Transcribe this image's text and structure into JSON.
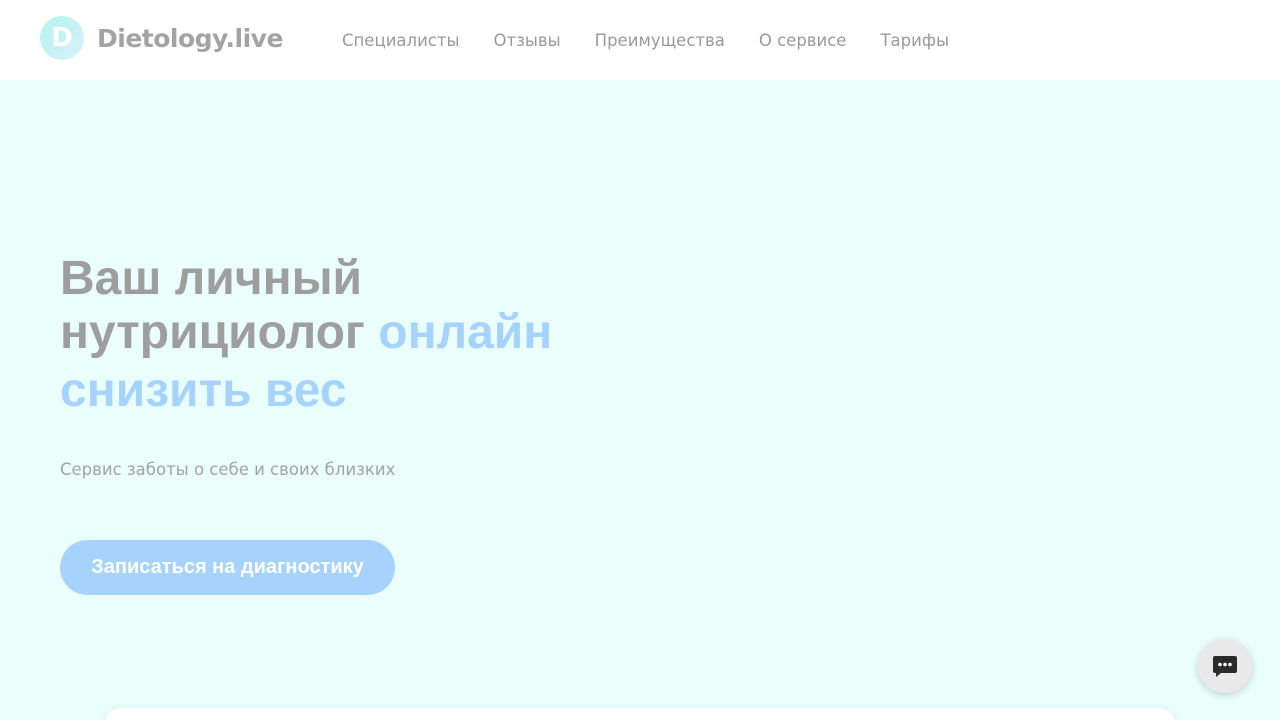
{
  "brand": {
    "logo_letter": "D",
    "name": "Dietology.live"
  },
  "nav": {
    "items": [
      {
        "label": "Специалисты"
      },
      {
        "label": "Отзывы"
      },
      {
        "label": "Преимущества"
      },
      {
        "label": "О сервисе"
      },
      {
        "label": "Тарифы"
      }
    ]
  },
  "hero": {
    "title_line1": "Ваш личный",
    "title_line2_plain": "нутрициолог",
    "title_line2_accent": "онлайн",
    "title_line3_accent": "снизить вес",
    "subtitle": "Сервис заботы о себе и своих близких",
    "cta_label": "Записаться на диагностику"
  },
  "icons": {
    "chat": "chat-bubble-icon"
  },
  "colors": {
    "background": "#eafefc",
    "accent": "#a6d3fb",
    "text_muted": "#9e9e9e",
    "logo_gradient_start": "#b3f5ee"
  }
}
